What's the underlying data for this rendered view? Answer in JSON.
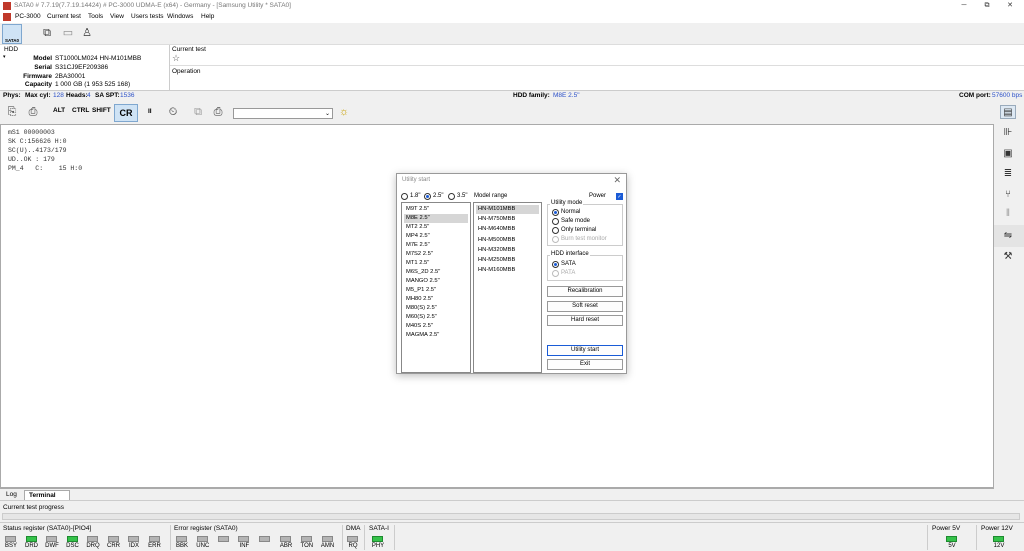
{
  "window": {
    "title": "SATA0 # 7.7.19(7.7.19.14424) # PC-3000 UDMA-E (x64) - Germany - [Samsung Utility * SATA0]",
    "buttons": [
      "─",
      "⧉",
      "✕"
    ]
  },
  "menu": [
    "PC-3000",
    "Current test",
    "Tools",
    "View",
    "Users tests",
    "Windows",
    "Help"
  ],
  "toolbar1": {
    "sata_label": "SATA0"
  },
  "hdd_info": {
    "section": "HDD",
    "model_label": "Model",
    "model": "ST1000LM024 HN-M101MBB",
    "serial_label": "Serial",
    "serial": "S31CJ9EF209386",
    "firmware_label": "Firmware",
    "firmware": "2BA30001",
    "capacity_label": "Capacity",
    "capacity": "1 000 GB (1 953 525 168)",
    "current_test_label": "Current test",
    "operation_label": "Operation"
  },
  "status_line": {
    "phys": "Phys:",
    "max_cyl_label": "Max cyl:",
    "max_cyl": "128",
    "heads_label": "Heads:",
    "heads": "4",
    "sa_spt_label": "SA SPT:",
    "sa_spt": "1536",
    "family_label": "HDD family:",
    "family": "M8E 2.5\"",
    "com_label": "COM port:",
    "com": "57600 bps"
  },
  "toolbar2": {
    "alt": "ALT",
    "ctrl": "CTRL",
    "shift": "SHIFT",
    "cr": "CR",
    "pause": "II"
  },
  "terminal": {
    "lines": [
      "mS1 00000003",
      "SK C:156626 H:0",
      "SC(U)..4173/179",
      "UD..OK : 179",
      "PM_4   C:    15 H:0"
    ]
  },
  "tabs": [
    "Log",
    "Terminal"
  ],
  "progress": {
    "label": "Current test progress"
  },
  "registers": {
    "status_title": "Status register (SATA0)-[PIO4]",
    "status_leds": [
      {
        "label": "BSY",
        "on": false
      },
      {
        "label": "DRD",
        "on": true
      },
      {
        "label": "DWF",
        "on": false
      },
      {
        "label": "DSC",
        "on": true
      },
      {
        "label": "DRQ",
        "on": false
      },
      {
        "label": "CRR",
        "on": false
      },
      {
        "label": "IDX",
        "on": false
      },
      {
        "label": "ERR",
        "on": false
      }
    ],
    "error_title": "Error register (SATA0)",
    "error_leds": [
      {
        "label": "BBK",
        "on": false
      },
      {
        "label": "UNC",
        "on": false
      },
      {
        "label": "",
        "on": false
      },
      {
        "label": "INF",
        "on": false
      },
      {
        "label": "",
        "on": false
      },
      {
        "label": "ABR",
        "on": false
      },
      {
        "label": "TON",
        "on": false
      },
      {
        "label": "AMN",
        "on": false
      }
    ],
    "dma_title": "DMA",
    "dma_led": {
      "label": "RQ",
      "on": false
    },
    "sata_title": "SATA-I",
    "sata_led": {
      "label": "PHY",
      "on": true
    },
    "p5_title": "Power 5V",
    "p5_led": {
      "label": "5V",
      "on": true
    },
    "p12_title": "Power 12V",
    "p12_led": {
      "label": "12V",
      "on": true
    }
  },
  "dialog": {
    "title": "Utility start",
    "close": "✕",
    "form_factors": [
      "1.8\"",
      "2.5\"",
      "3.5\""
    ],
    "form_selected": 1,
    "model_range_label": "Model range",
    "families": [
      "M9T 2.5\"",
      "M8E 2.5\"",
      "MT2 2.5\"",
      "MP4 2.5\"",
      "M7E 2.5\"",
      "M7S2 2.5\"",
      "MT1 2.5\"",
      "M6S_2D 2.5\"",
      "MANGO 2.5\"",
      "M5_P1 2.5\"",
      "MH80 2.5\"",
      "M80(S) 2.5\"",
      "M60(S) 2.5\"",
      "M40S 2.5\"",
      "MAGMA 2.5\""
    ],
    "family_selected": 1,
    "models": [
      "HN-M101MBB",
      "HN-M750MBB",
      "HN-M640MBB",
      "HN-M500MBB",
      "HN-M320MBB",
      "HN-M250MBB",
      "HN-M160MBB"
    ],
    "model_selected": 0,
    "power_label": "Power",
    "utility_mode_label": "Utility mode",
    "modes": [
      "Normal",
      "Safe mode",
      "Only terminal",
      "Burn test monitor"
    ],
    "hdd_interface_label": "HDD interface",
    "interfaces": [
      "SATA",
      "PATA"
    ],
    "recalibration": "Recalibration",
    "soft_reset": "Soft reset",
    "hard_reset": "Hard reset",
    "utility_start": "Utility start",
    "exit": "Exit"
  }
}
